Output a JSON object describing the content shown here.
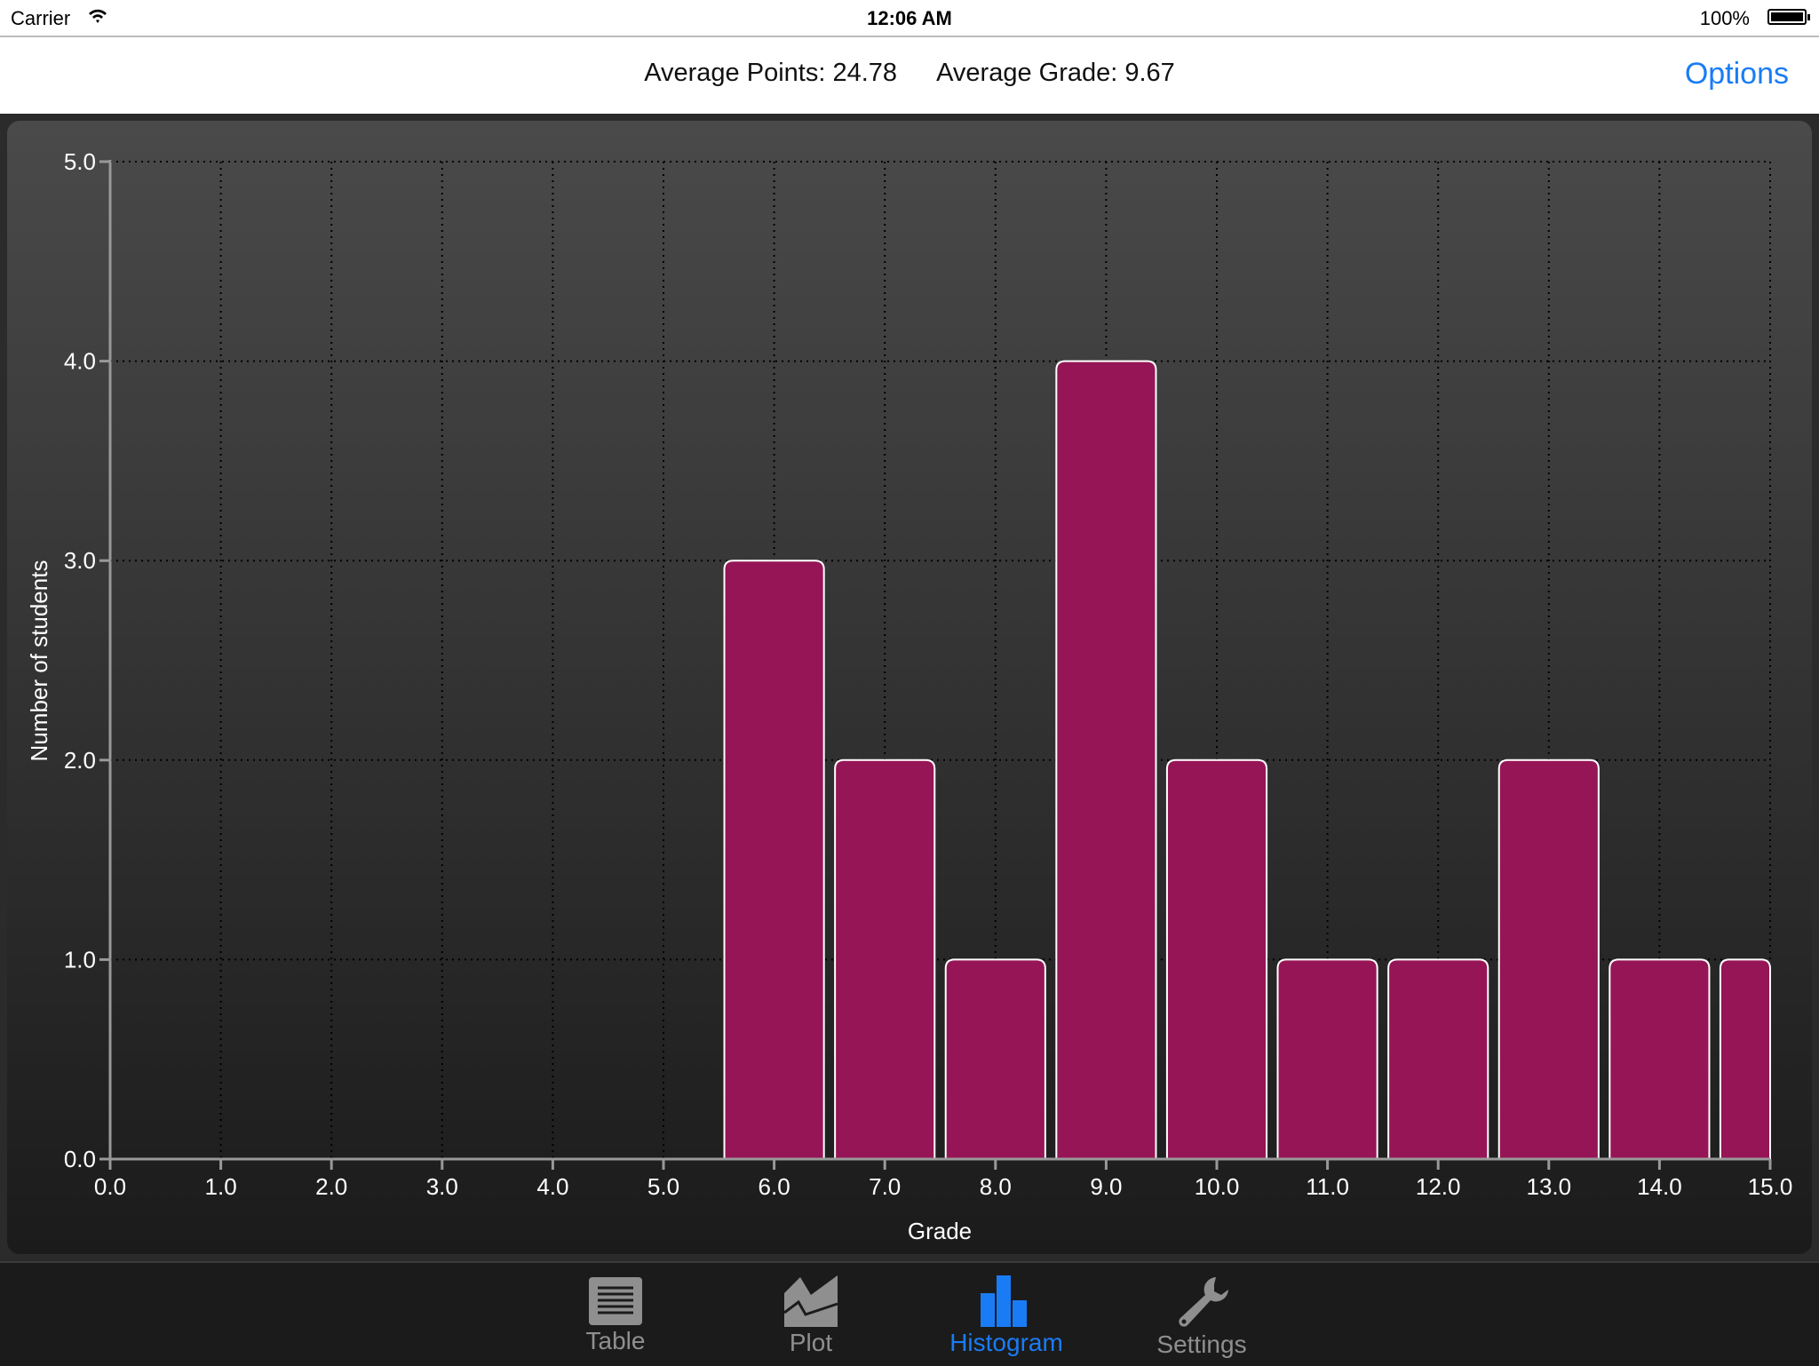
{
  "status_bar": {
    "carrier": "Carrier",
    "time": "12:06 AM",
    "battery": "100%"
  },
  "nav": {
    "average_points": "Average Points: 24.78",
    "average_grade": "Average Grade: 9.67",
    "options_label": "Options"
  },
  "colors": {
    "bar_fill": "#961556",
    "bar_stroke": "#ffffff",
    "accent": "#1a7cf5",
    "tab_inactive": "#8f8f8f"
  },
  "chart_data": {
    "type": "bar",
    "xlabel": "Grade",
    "ylabel": "Number of students",
    "xlim": [
      0,
      15
    ],
    "ylim": [
      0,
      5
    ],
    "grid": true,
    "x_ticks": [
      "0.0",
      "1.0",
      "2.0",
      "3.0",
      "4.0",
      "5.0",
      "6.0",
      "7.0",
      "8.0",
      "9.0",
      "10.0",
      "11.0",
      "12.0",
      "13.0",
      "14.0",
      "15.0"
    ],
    "y_ticks": [
      "0.0",
      "1.0",
      "2.0",
      "3.0",
      "4.0",
      "5.0"
    ],
    "x": [
      6,
      7,
      8,
      9,
      10,
      11,
      12,
      13,
      14,
      15
    ],
    "values": [
      3,
      2,
      1,
      4,
      2,
      1,
      1,
      2,
      1,
      1
    ]
  },
  "tabs": [
    {
      "label": "Table",
      "icon": "table-icon",
      "active": false
    },
    {
      "label": "Plot",
      "icon": "plot-icon",
      "active": false
    },
    {
      "label": "Histogram",
      "icon": "histogram-icon",
      "active": true
    },
    {
      "label": "Settings",
      "icon": "wrench-icon",
      "active": false
    }
  ]
}
